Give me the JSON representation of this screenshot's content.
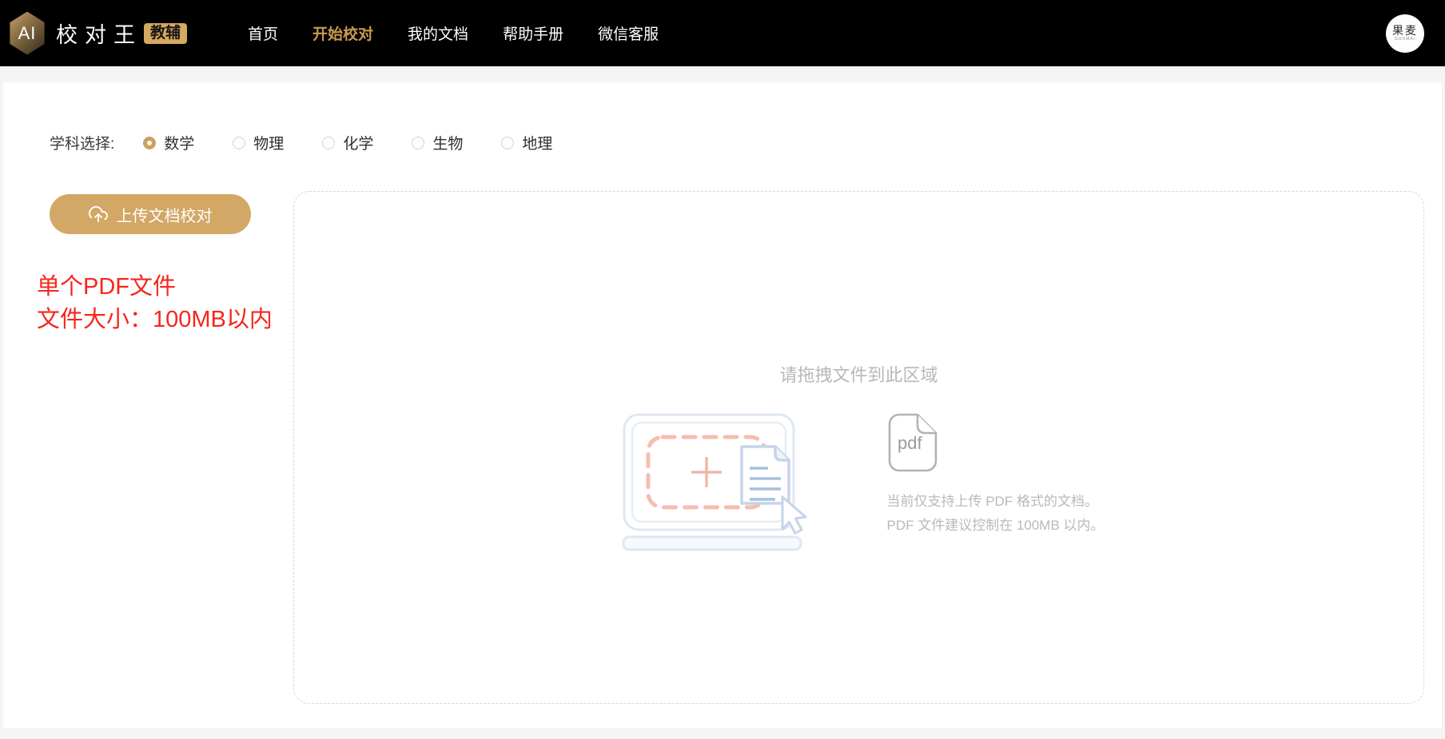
{
  "header": {
    "logo": {
      "ai": "AI",
      "title": "校对王",
      "badge": "教辅"
    },
    "nav": [
      {
        "label": "首页",
        "active": false
      },
      {
        "label": "开始校对",
        "active": true
      },
      {
        "label": "我的文档",
        "active": false
      },
      {
        "label": "帮助手册",
        "active": false
      },
      {
        "label": "微信客服",
        "active": false
      }
    ],
    "brand_avatar": {
      "line1": "果麦",
      "line2": "GUOMAI"
    }
  },
  "subject": {
    "label": "学科选择:",
    "options": [
      {
        "label": "数学",
        "selected": true
      },
      {
        "label": "物理",
        "selected": false
      },
      {
        "label": "化学",
        "selected": false
      },
      {
        "label": "生物",
        "selected": false
      },
      {
        "label": "地理",
        "selected": false
      }
    ]
  },
  "upload": {
    "button_label": "上传文档校对",
    "notice_line1": "单个PDF文件",
    "notice_line2": "文件大小：100MB以内"
  },
  "dropzone": {
    "title": "请拖拽文件到此区域",
    "pdf_icon_label": "pdf",
    "hint_line1": "当前仅支持上传 PDF 格式的文档。",
    "hint_line2": "PDF 文件建议控制在 100MB 以内。"
  },
  "colors": {
    "header_bg": "#000000",
    "accent_gold": "#d3a765",
    "nav_active": "#c89a4f",
    "badge_gold": "#d6a75f",
    "notice_red": "#f5261c",
    "dropzone_border": "#d9d9d9",
    "muted_text": "#b8b8b8",
    "illustration_blue": "#c9d7ea",
    "illustration_salmon": "#f6bdb0"
  }
}
